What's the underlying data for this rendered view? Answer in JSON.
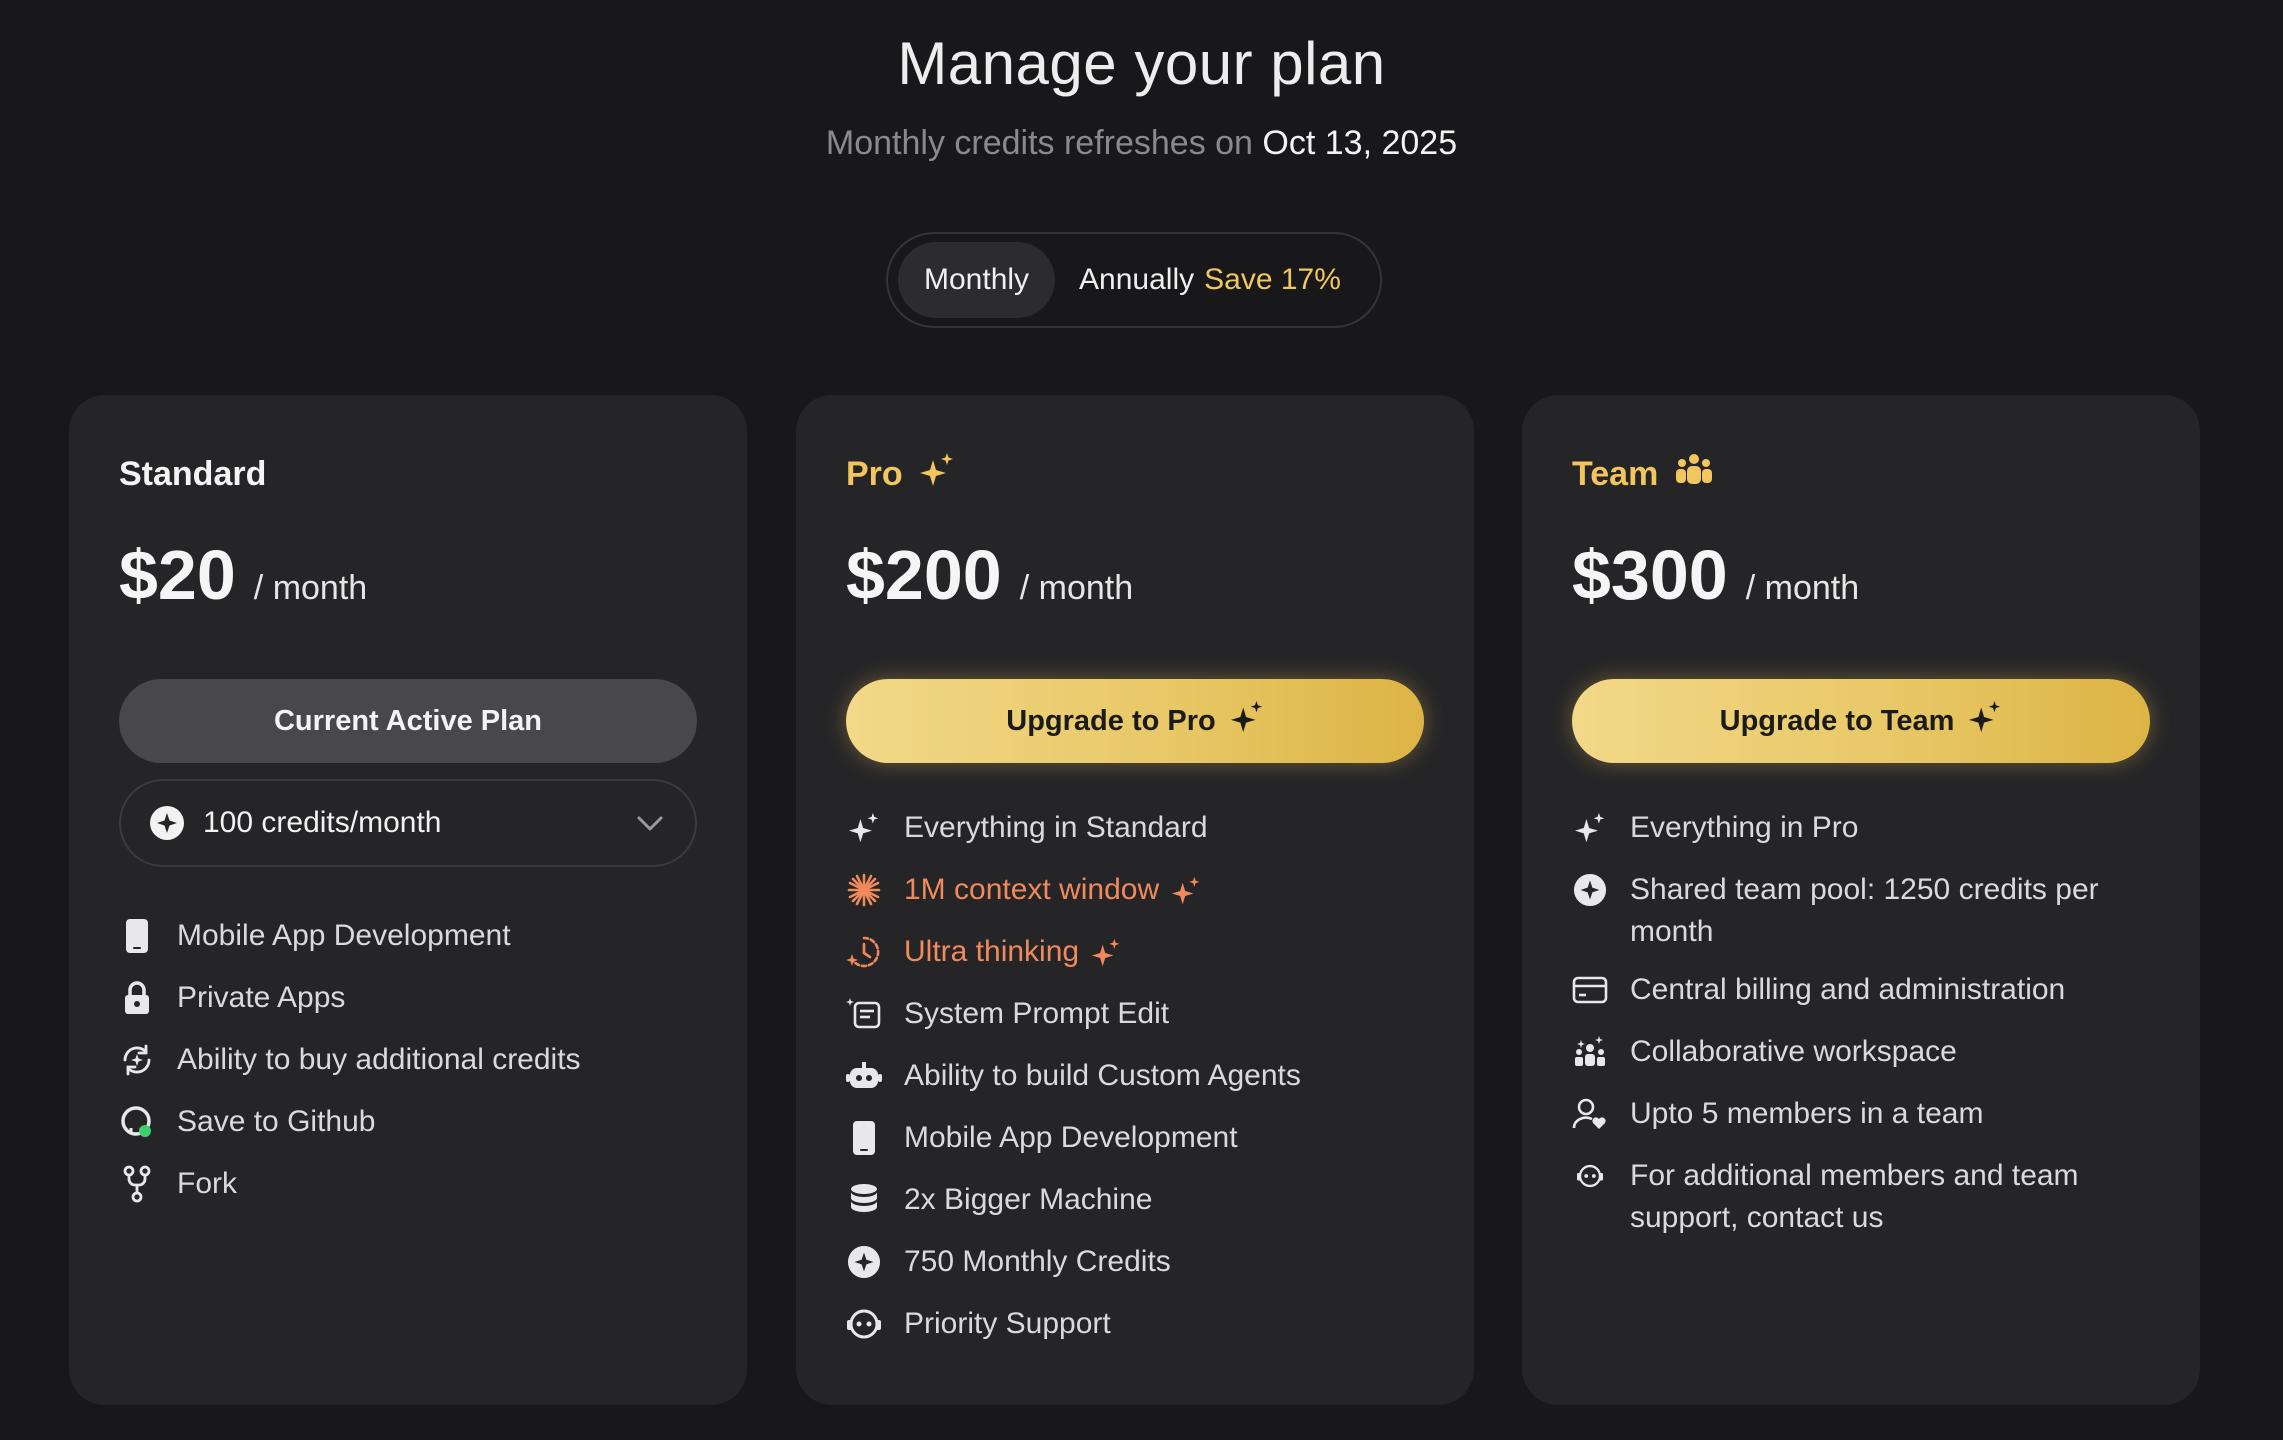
{
  "header": {
    "title": "Manage your plan",
    "subtitle_prefix": "Monthly credits refreshes on",
    "refresh_date": "Oct 13, 2025"
  },
  "billing_toggle": {
    "monthly_label": "Monthly",
    "annually_label": "Annually",
    "save_badge": "Save 17%",
    "selected": "Monthly"
  },
  "colors": {
    "background": "#18181a",
    "card": "#252527",
    "accent_gold": "#f2c55e",
    "highlight_orange": "#f08a5d"
  },
  "plans": [
    {
      "name": "Standard",
      "price": "$20",
      "period": "/ month",
      "cta_label": "Current Active Plan",
      "credits_select": "100 credits/month",
      "features": [
        {
          "icon": "phone-icon",
          "text": "Mobile App Development"
        },
        {
          "icon": "lock-icon",
          "text": "Private Apps"
        },
        {
          "icon": "credit-refresh-icon",
          "text": "Ability to buy additional credits"
        },
        {
          "icon": "github-icon",
          "text": "Save to Github"
        },
        {
          "icon": "fork-icon",
          "text": "Fork"
        }
      ]
    },
    {
      "name": "Pro",
      "price": "$200",
      "period": "/ month",
      "cta_label": "Upgrade to Pro",
      "features": [
        {
          "icon": "sparkle-icon",
          "text": "Everything in Standard"
        },
        {
          "icon": "burst-icon",
          "text": "1M context window"
        },
        {
          "icon": "thinking-icon",
          "text": "Ultra thinking"
        },
        {
          "icon": "prompt-edit-icon",
          "text": "System Prompt Edit"
        },
        {
          "icon": "agent-icon",
          "text": "Ability to build Custom Agents"
        },
        {
          "icon": "phone-icon",
          "text": "Mobile App Development"
        },
        {
          "icon": "database-icon",
          "text": "2x Bigger Machine"
        },
        {
          "icon": "credits-icon",
          "text": "750 Monthly Credits"
        },
        {
          "icon": "support-icon",
          "text": "Priority Support"
        }
      ]
    },
    {
      "name": "Team",
      "price": "$300",
      "period": "/ month",
      "cta_label": "Upgrade to Team",
      "features": [
        {
          "icon": "sparkle-icon",
          "text": "Everything in Pro"
        },
        {
          "icon": "credits-icon",
          "text": "Shared team pool: 1250 credits per month"
        },
        {
          "icon": "card-icon",
          "text": "Central billing and administration"
        },
        {
          "icon": "workspace-icon",
          "text": "Collaborative workspace"
        },
        {
          "icon": "user-heart-icon",
          "text": "Upto 5 members in a team"
        },
        {
          "icon": "support-icon",
          "text": "For additional members and team support, contact us"
        }
      ]
    }
  ]
}
